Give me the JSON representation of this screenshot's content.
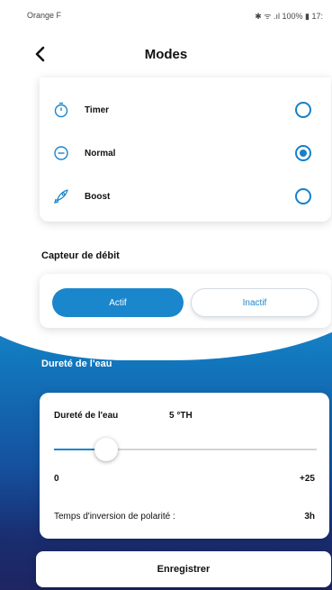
{
  "statusbar": {
    "carrier": "Orange F",
    "right": "✱ ᯤ .ıl 100% ▮ 17:"
  },
  "nav": {
    "title": "Modes"
  },
  "modes": [
    {
      "label": "Timer",
      "icon": "timer-icon",
      "selected": false
    },
    {
      "label": "Normal",
      "icon": "minus-circle-icon",
      "selected": true
    },
    {
      "label": "Boost",
      "icon": "rocket-icon",
      "selected": false
    }
  ],
  "debit": {
    "section_label": "Capteur de débit",
    "active_label": "Actif",
    "inactive_label": "Inactif",
    "selected": "Actif"
  },
  "durete": {
    "section_label": "Dureté de l'eau",
    "field_label": "Dureté de l'eau",
    "value": "5 °TH",
    "min_label": "0",
    "max_label": "+25",
    "slider_fraction": 0.2,
    "polarity_label": "Temps d'inversion de polarité :",
    "polarity_value": "3h"
  },
  "save_label": "Enregistrer",
  "colors": {
    "accent": "#1a86cc",
    "gradient_top": "#1f8fd0",
    "gradient_bottom": "#1e2562"
  }
}
